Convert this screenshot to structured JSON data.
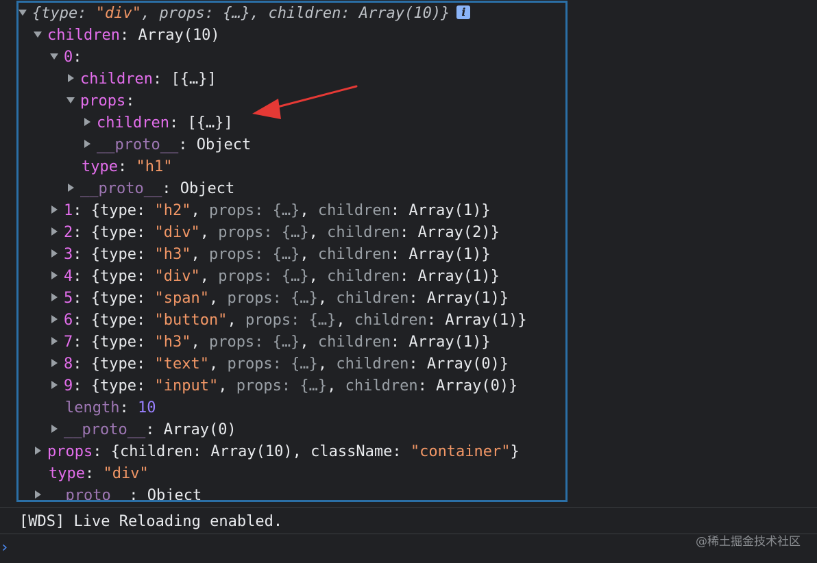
{
  "console": {
    "root_summary": {
      "open": "{",
      "type_key": "type",
      "type_val": "\"div\"",
      "props_key": "props",
      "props_val": "{…}",
      "children_key": "children",
      "children_val": "Array(10)",
      "close": "}"
    },
    "info_badge": "i",
    "children_label": "children",
    "children_value": "Array(10)",
    "index0": "0",
    "item0_children_key": "children",
    "item0_children_val": "[{…}]",
    "item0_props_key": "props",
    "item0_props_children_key": "children",
    "item0_props_children_val": "[{…}]",
    "proto_key": "__proto__",
    "object_label": "Object",
    "type_key": "type",
    "item0_type_val": "\"h1\"",
    "items": [
      {
        "index": "1",
        "type": "\"h2\"",
        "children": "Array(1)"
      },
      {
        "index": "2",
        "type": "\"div\"",
        "children": "Array(2)"
      },
      {
        "index": "3",
        "type": "\"h3\"",
        "children": "Array(1)"
      },
      {
        "index": "4",
        "type": "\"div\"",
        "children": "Array(1)"
      },
      {
        "index": "5",
        "type": "\"span\"",
        "children": "Array(1)"
      },
      {
        "index": "6",
        "type": "\"button\"",
        "children": "Array(1)"
      },
      {
        "index": "7",
        "type": "\"h3\"",
        "children": "Array(1)"
      },
      {
        "index": "8",
        "type": "\"text\"",
        "children": "Array(0)"
      },
      {
        "index": "9",
        "type": "\"input\"",
        "children": "Array(0)"
      }
    ],
    "item_props_text": "props: {…}",
    "item_children_key": "children",
    "length_key": "length",
    "length_val": "10",
    "array_proto_val": "Array(0)",
    "root_props_key": "props",
    "root_props_open": "{children: Array(10), className: ",
    "root_props_classname": "\"container\"",
    "root_props_close": "}",
    "root_type_val": "\"div\"",
    "wds_message": "[WDS] Live Reloading enabled.",
    "watermark": "@稀土掘金技术社区"
  },
  "colors": {
    "background": "#202124",
    "panel_border": "#2b6fa6",
    "key": "#e36eec",
    "string": "#f29766",
    "number": "#9980ff",
    "arrow": "#e53935"
  }
}
